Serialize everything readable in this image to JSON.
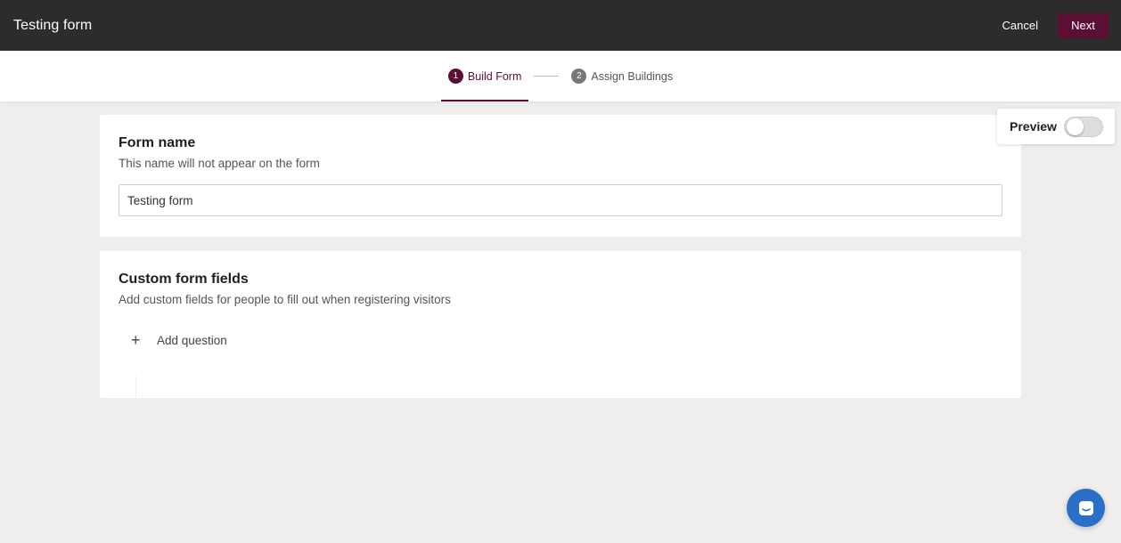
{
  "header": {
    "title": "Testing form",
    "cancel_label": "Cancel",
    "next_label": "Next"
  },
  "stepper": {
    "steps": [
      {
        "number": "1",
        "label": "Build Form",
        "active": true
      },
      {
        "number": "2",
        "label": "Assign Buildings",
        "active": false
      }
    ]
  },
  "form_name_card": {
    "title": "Form name",
    "subtitle": "This name will not appear on the form",
    "input_value": "Testing form"
  },
  "custom_fields_card": {
    "title": "Custom form fields",
    "subtitle": "Add custom fields for people to fill out when registering visitors",
    "add_question_label": "Add question",
    "add_question_icon": "plus-icon"
  },
  "preview": {
    "label": "Preview",
    "enabled": false
  },
  "chat": {
    "icon": "chat-icon"
  },
  "colors": {
    "brand": "#5b0f35",
    "header_bg": "#2c2c2c",
    "chat_bg": "#2a70c9"
  }
}
